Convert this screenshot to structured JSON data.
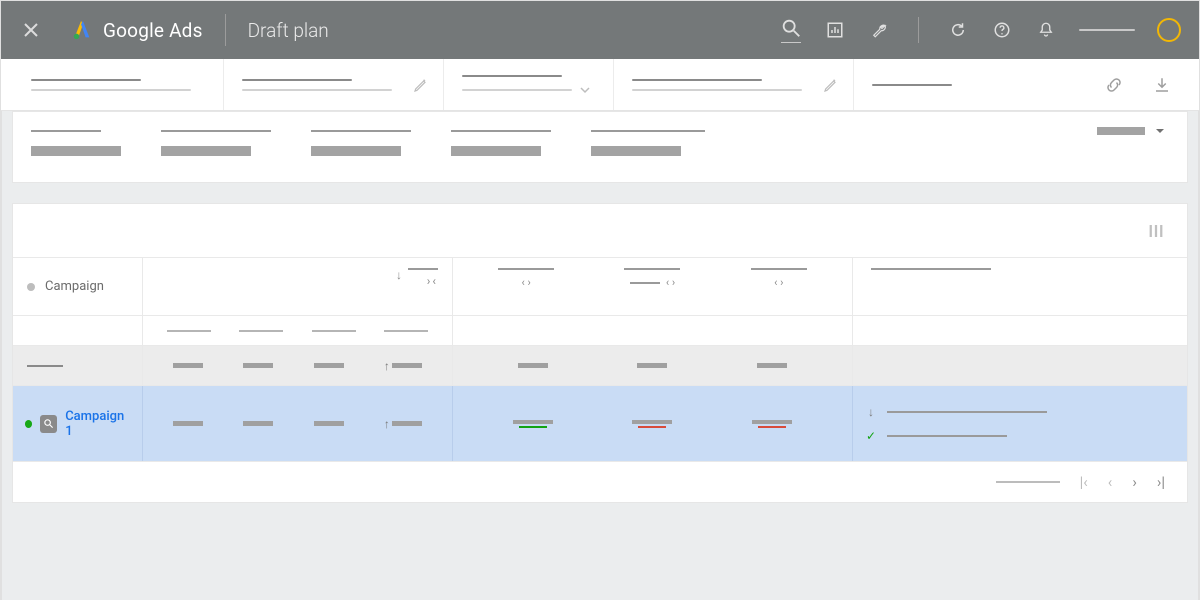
{
  "header": {
    "product": "Google Ads",
    "title": "Draft plan"
  },
  "subbar": {
    "cells": [
      "",
      "",
      "",
      "",
      ""
    ]
  },
  "summary": {
    "metrics": [
      {
        "label": "",
        "value": ""
      },
      {
        "label": "",
        "value": ""
      },
      {
        "label": "",
        "value": ""
      },
      {
        "label": "",
        "value": ""
      },
      {
        "label": "",
        "value": ""
      }
    ],
    "dropdown_label": ""
  },
  "table": {
    "columns": {
      "campaign": "Campaign",
      "group2_sub": [
        "",
        "",
        "",
        ""
      ],
      "group3": [
        "",
        "",
        ""
      ],
      "last": ""
    },
    "totals": {
      "label": "",
      "g2": [
        "",
        "",
        "",
        ""
      ],
      "g3": [
        "",
        "",
        ""
      ]
    },
    "rows": [
      {
        "status": "enabled",
        "type": "search",
        "name": "Campaign 1",
        "g2": [
          "",
          "",
          "",
          ""
        ],
        "g3": [
          {
            "delta": "green"
          },
          {
            "delta": "red"
          },
          {
            "delta": "red"
          }
        ],
        "notes": [
          {
            "mark": "down",
            "text": ""
          },
          {
            "mark": "check",
            "text": ""
          }
        ]
      }
    ],
    "pager": {
      "range": ""
    }
  },
  "colors": {
    "accent_blue": "#1a73e8",
    "green": "#12a312",
    "red": "#d84b3a",
    "header_bg": "#747879",
    "selected_row": "#c9dcf5"
  }
}
